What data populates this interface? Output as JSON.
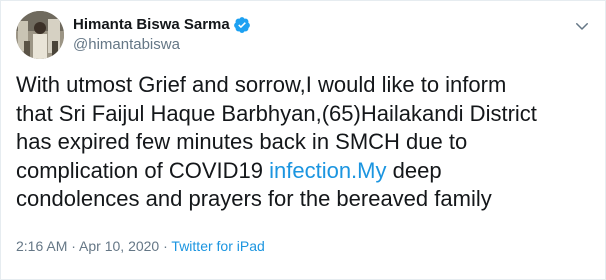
{
  "author": {
    "display_name": "Himanta Biswa Sarma",
    "handle": "@himantabiswa",
    "verified": true
  },
  "tweet": {
    "line1": "With utmost Grief and sorrow,I would like to inform",
    "line2": "that Sri Faijul Haque Barbhyan,(65)Hailakandi District",
    "line3": "has expired few minutes back in SMCH due to",
    "line4_pre": "complication of COVID19 ",
    "line4_link": "infection.My",
    "line4_post": " deep",
    "line5": "condolences and prayers for the bereaved family"
  },
  "meta": {
    "time": "2:16 AM",
    "separator1": " · ",
    "date": "Apr 10, 2020",
    "separator2": " · ",
    "source": "Twitter for iPad"
  },
  "colors": {
    "link": "#1b95e0",
    "secondary_text": "#657786",
    "verified_badge": "#1da1f2"
  },
  "icons": {
    "verified": "verified-badge-icon",
    "more": "chevron-down-icon"
  }
}
